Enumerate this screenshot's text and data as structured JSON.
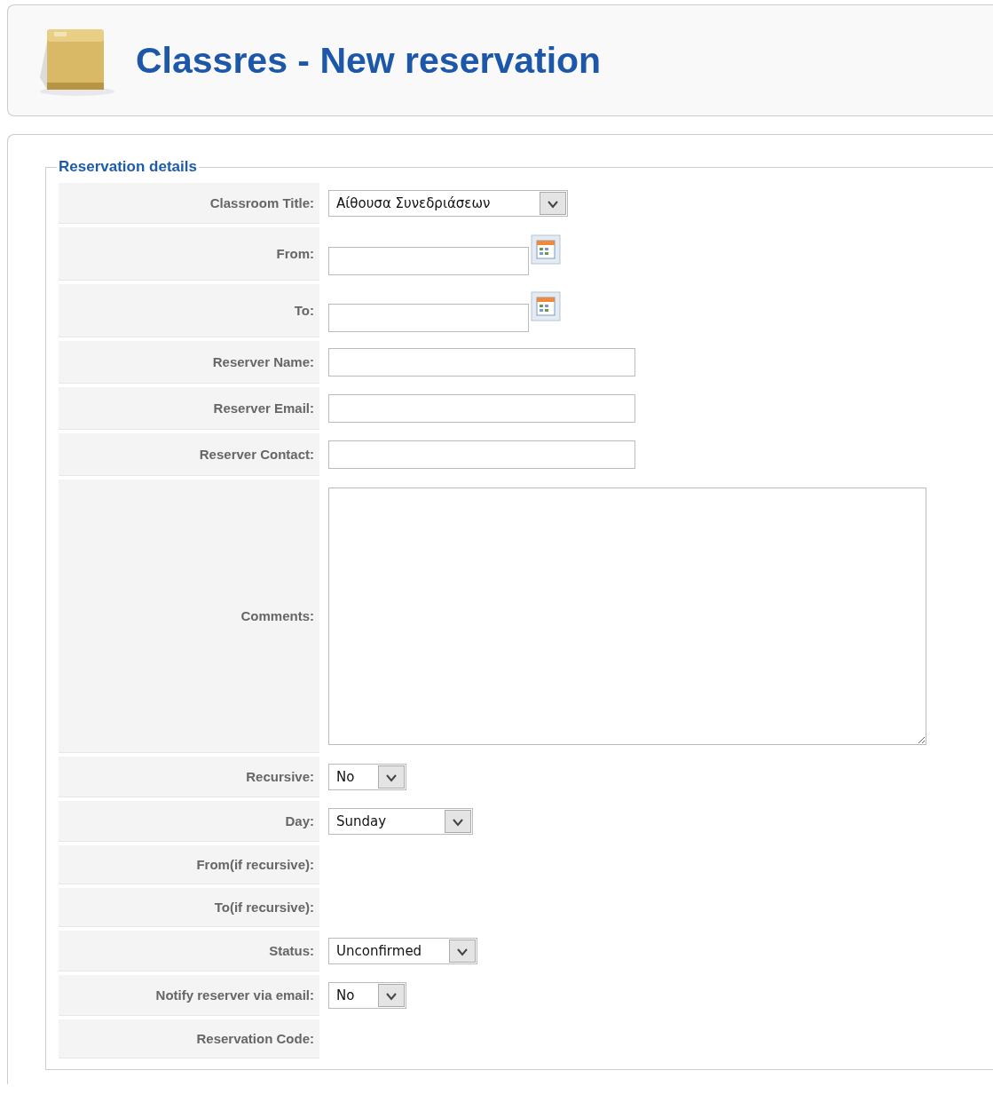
{
  "header": {
    "title": "Classres - New reservation"
  },
  "fieldset": {
    "legend": "Reservation details",
    "fields": [
      {
        "kind": "select",
        "label": "Classroom Title:",
        "value": "Αίθουσα Συνεδριάσεων"
      },
      {
        "kind": "date",
        "label": "From:"
      },
      {
        "kind": "date",
        "label": "To:"
      },
      {
        "kind": "text",
        "label": "Reserver Name:"
      },
      {
        "kind": "text",
        "label": "Reserver Email:"
      },
      {
        "kind": "text",
        "label": "Reserver Contact:"
      },
      {
        "kind": "textarea",
        "label": "Comments:"
      },
      {
        "kind": "select",
        "label": "Recursive:",
        "value": "No"
      },
      {
        "kind": "select",
        "label": "Day:",
        "value": "Sunday"
      },
      {
        "kind": "empty",
        "label": "From(if recursive):"
      },
      {
        "kind": "empty",
        "label": "To(if recursive):"
      },
      {
        "kind": "select",
        "label": "Status:",
        "value": "Unconfirmed"
      },
      {
        "kind": "select",
        "label": "Notify reserver via email:",
        "value": "No"
      },
      {
        "kind": "empty",
        "label": "Reservation Code:"
      }
    ]
  }
}
